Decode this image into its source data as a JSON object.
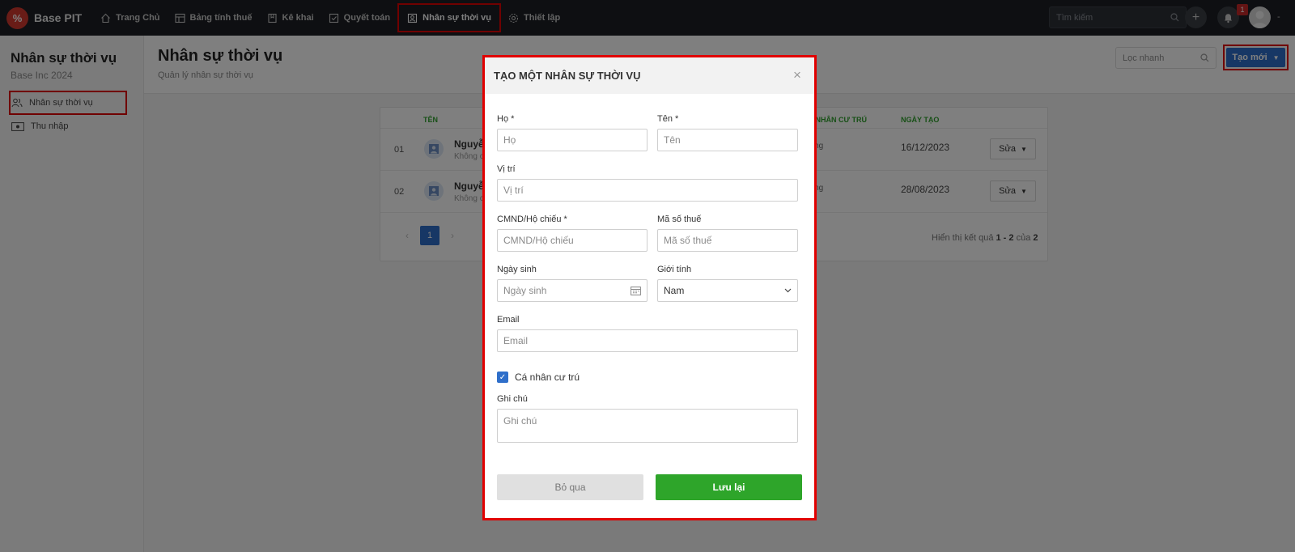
{
  "app": {
    "logo_text": "%",
    "name": "Base PIT"
  },
  "nav": {
    "items": [
      {
        "label": "Trang Chủ",
        "icon": "home-icon"
      },
      {
        "label": "Bảng tính thuế",
        "icon": "table-icon"
      },
      {
        "label": "Kê khai",
        "icon": "bookmark-icon"
      },
      {
        "label": "Quyết toán",
        "icon": "check-square-icon"
      },
      {
        "label": "Nhân sự thời vụ",
        "icon": "user-card-icon",
        "active": true
      },
      {
        "label": "Thiết lập",
        "icon": "gear-icon"
      }
    ],
    "search_placeholder": "Tìm kiếm",
    "notification_count": "1",
    "add_label": "+",
    "avatar_caret": "-"
  },
  "sidebar": {
    "title": "Nhân sự thời vụ",
    "subtitle": "Base Inc 2024",
    "items": [
      {
        "label": "Nhân sự thời vụ",
        "icon": "users-icon",
        "active": true
      },
      {
        "label": "Thu nhập",
        "icon": "money-icon"
      }
    ]
  },
  "header": {
    "title": "Nhân sự thời vụ",
    "subtitle": "Quản lý nhân sự thời vụ",
    "filter_placeholder": "Lọc nhanh",
    "create_label": "Tạo mới"
  },
  "table": {
    "columns": {
      "name": "TÊN",
      "resident": "CÁ NHÂN CƯ TRÚ",
      "created": "NGÀY TẠO"
    },
    "rows": [
      {
        "no": "01",
        "name": "Nguyễ",
        "sub": "Không c",
        "resident": "hông",
        "date": "16/12/2023",
        "edit": "Sửa"
      },
      {
        "no": "02",
        "name": "Nguyễ",
        "sub": "Không c",
        "resident": "hông",
        "date": "28/08/2023",
        "edit": "Sửa"
      }
    ],
    "pagination": {
      "prev": "‹",
      "current": "1",
      "next": "›",
      "info_prefix": "Hiển thị kết quả",
      "range": "1 - 2",
      "of": "của",
      "total": "2"
    }
  },
  "modal": {
    "title": "TẠO MỘT NHÂN SỰ THỜI VỤ",
    "close": "×",
    "fields": {
      "last_name": {
        "label": "Họ *",
        "placeholder": "Họ"
      },
      "first_name": {
        "label": "Tên *",
        "placeholder": "Tên"
      },
      "position": {
        "label": "Vị trí",
        "placeholder": "Vị trí"
      },
      "id_card": {
        "label": "CMND/Hộ chiếu *",
        "placeholder": "CMND/Hộ chiếu"
      },
      "tax_code": {
        "label": "Mã số thuế",
        "placeholder": "Mã số thuế"
      },
      "birthday": {
        "label": "Ngày sinh",
        "placeholder": "Ngày sinh"
      },
      "gender": {
        "label": "Giới tính",
        "value": "Nam"
      },
      "email": {
        "label": "Email",
        "placeholder": "Email"
      },
      "resident": {
        "label": "Cá nhân cư trú",
        "checked": true
      },
      "note": {
        "label": "Ghi chú",
        "placeholder": "Ghi chú"
      }
    },
    "cancel_label": "Bỏ qua",
    "save_label": "Lưu lại"
  },
  "colors": {
    "accent_blue": "#2f6fca",
    "save_green": "#2ea52a",
    "highlight_red": "#e10000",
    "column_header_green": "#2fa12c"
  }
}
